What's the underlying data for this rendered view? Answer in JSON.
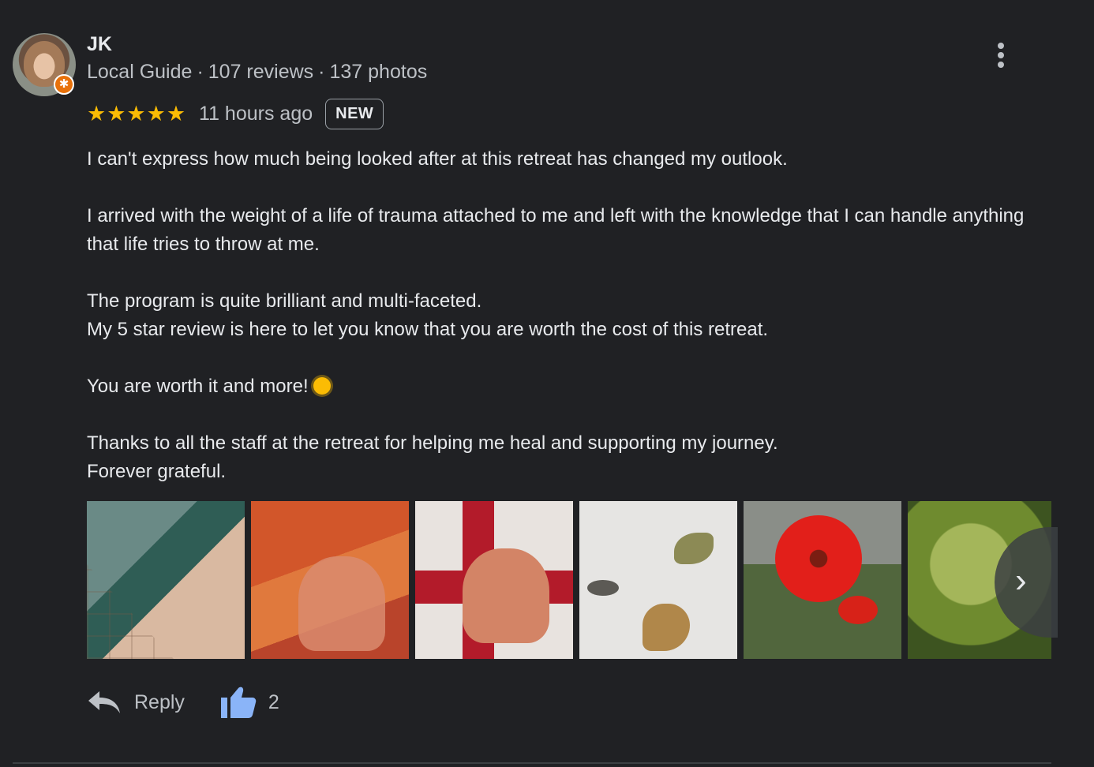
{
  "reviewer": {
    "name": "JK",
    "guide_label": "Local Guide",
    "reviews": "107 reviews",
    "photos": "137 photos",
    "separator": "·"
  },
  "review": {
    "stars_text": "★★★★★",
    "rating": 5,
    "time": "11 hours ago",
    "badge": "NEW",
    "paragraphs": [
      "I can't express how much being looked after at this retreat has changed my outlook.",
      "I arrived with the weight of a life of trauma attached to me and left with the knowledge that I can handle anything that life tries to throw at me.",
      "The program is quite brilliant and multi-faceted.\nMy 5 star review is here to let you know that you are worth the cost of this retreat.",
      "You are worth it and more!",
      "Thanks to all the staff at the retreat for helping me heal and supporting my journey.\nForever grateful."
    ]
  },
  "actions": {
    "reply_label": "Reply",
    "like_count": "2"
  },
  "colors": {
    "background": "#202124",
    "star": "#fbbc04",
    "like_icon": "#8ab4f8",
    "guide_badge": "#e8710a"
  },
  "icons": [
    "more-vert-icon",
    "reply-icon",
    "thumbs-up-icon",
    "chevron-right-icon",
    "local-guide-badge-icon",
    "sun-emoji-icon"
  ]
}
